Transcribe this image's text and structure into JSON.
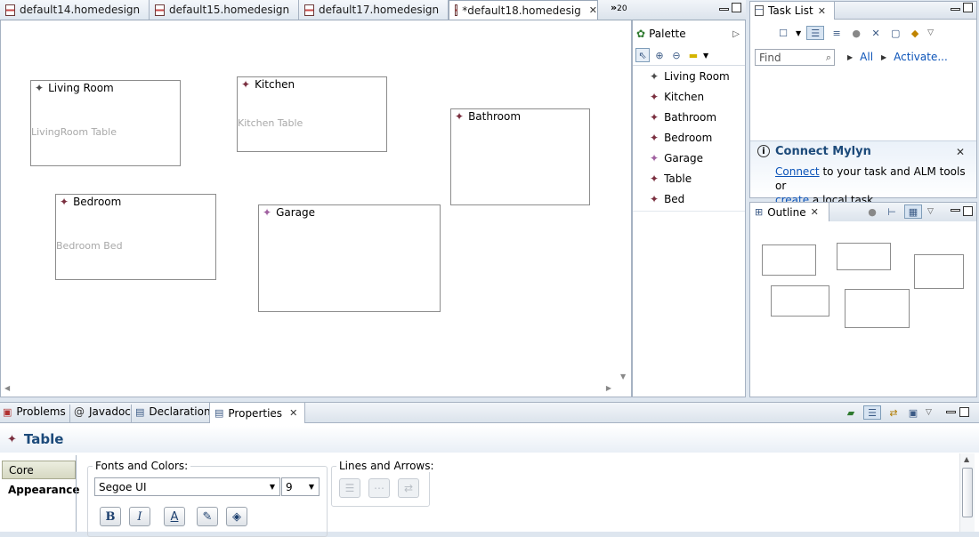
{
  "editor": {
    "tabs": [
      {
        "label": "default14.homedesign"
      },
      {
        "label": "default15.homedesign"
      },
      {
        "label": "default17.homedesign"
      },
      {
        "label": "*default18.homedesig"
      }
    ],
    "overflow_label": "»",
    "overflow_count": "20",
    "nodes": [
      {
        "name": "Living Room",
        "content": "LivingRoom Table"
      },
      {
        "name": "Kitchen",
        "content": "Kitchen Table"
      },
      {
        "name": "Bathroom",
        "content": ""
      },
      {
        "name": "Bedroom",
        "content": "Bedroom Bed"
      },
      {
        "name": "Garage",
        "content": ""
      }
    ]
  },
  "palette": {
    "title": "Palette",
    "items": [
      "Living Room",
      "Kitchen",
      "Bathroom",
      "Bedroom",
      "Garage",
      "Table",
      "Bed"
    ]
  },
  "tasklist": {
    "title": "Task List",
    "find_placeholder": "Find",
    "all_label": "All",
    "activate_label": "Activate...",
    "connect_title": "Connect Mylyn",
    "connect_link": "Connect",
    "connect_text1": " to your task and ALM tools or",
    "create_link": "create",
    "connect_text2": " a local task."
  },
  "outline": {
    "title": "Outline"
  },
  "bottom": {
    "tabs": [
      "Problems",
      "Javadoc",
      "Declaration",
      "Properties"
    ],
    "properties_title": "Table",
    "side_tabs": [
      "Core",
      "Appearance"
    ],
    "fonts_label": "Fonts and Colors:",
    "font_value": "Segoe UI",
    "size_value": "9",
    "lines_label": "Lines and Arrows:"
  },
  "colors": {
    "accent": "#1c4a7a",
    "node_border": "#8c8c8c",
    "star_room": "#7a2f3f",
    "star_garage": "#a060a0"
  }
}
